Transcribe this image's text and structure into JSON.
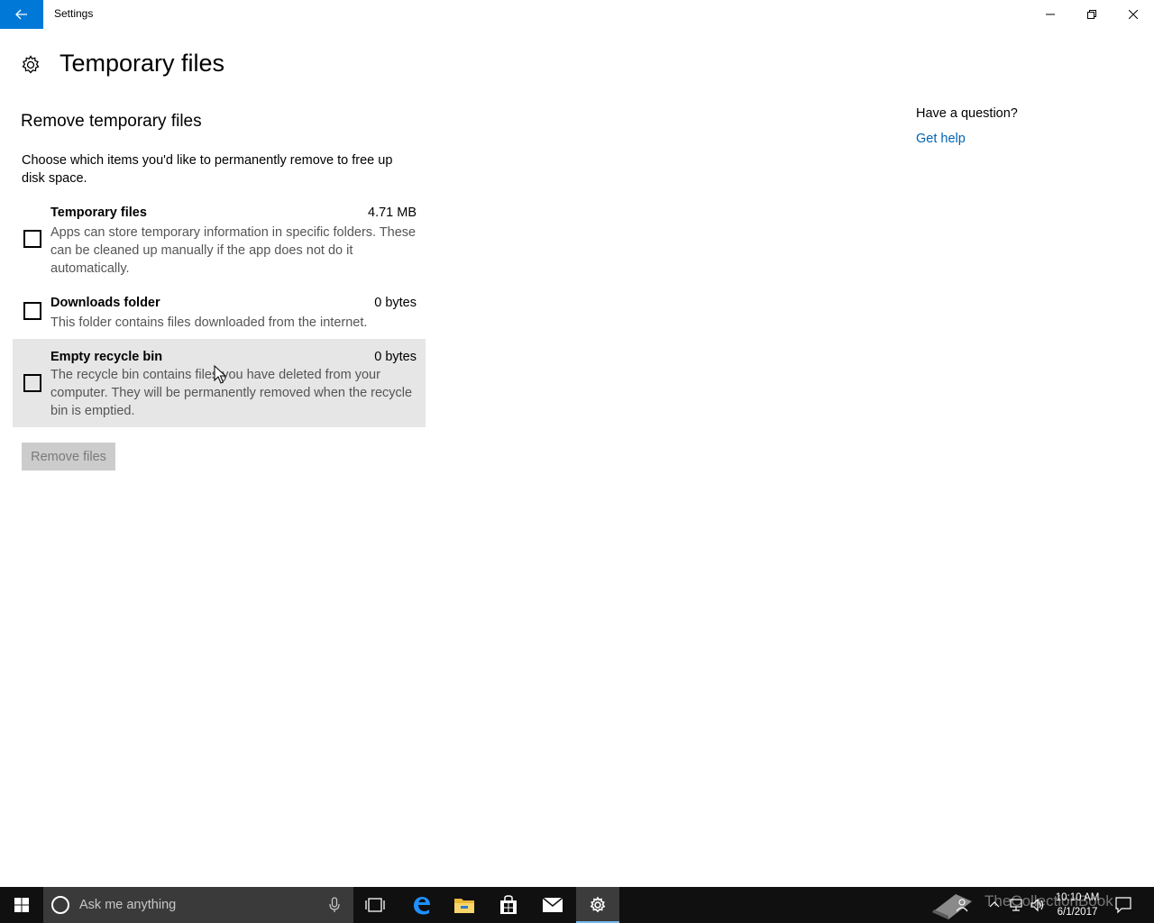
{
  "window": {
    "title": "Settings"
  },
  "page": {
    "title": "Temporary files",
    "section_title": "Remove temporary files",
    "intro": "Choose which items you'd like to permanently remove to free up disk space."
  },
  "items": [
    {
      "name": "Temporary files",
      "size": "4.71 MB",
      "description": "Apps can store temporary information in specific folders. These can be cleaned up manually if the app does not do it automatically.",
      "checked": false
    },
    {
      "name": "Downloads folder",
      "size": "0 bytes",
      "description": "This folder contains files downloaded from the internet.",
      "checked": false
    },
    {
      "name": "Empty recycle bin",
      "size": "0 bytes",
      "description": "The recycle bin contains files you have deleted from your computer. They will be permanently removed when the recycle bin is emptied.",
      "checked": false
    }
  ],
  "remove_button": {
    "label": "Remove files",
    "enabled": false
  },
  "help": {
    "question": "Have a question?",
    "link": "Get help"
  },
  "taskbar": {
    "search_placeholder": "Ask me anything",
    "watermark": "TheCollectionBook",
    "clock_time": "10:10 AM",
    "clock_date": "6/1/2017"
  },
  "colors": {
    "accent": "#0078d7",
    "link": "#0063b1",
    "hover_row": "#e6e6e6",
    "taskbar": "#101010"
  }
}
